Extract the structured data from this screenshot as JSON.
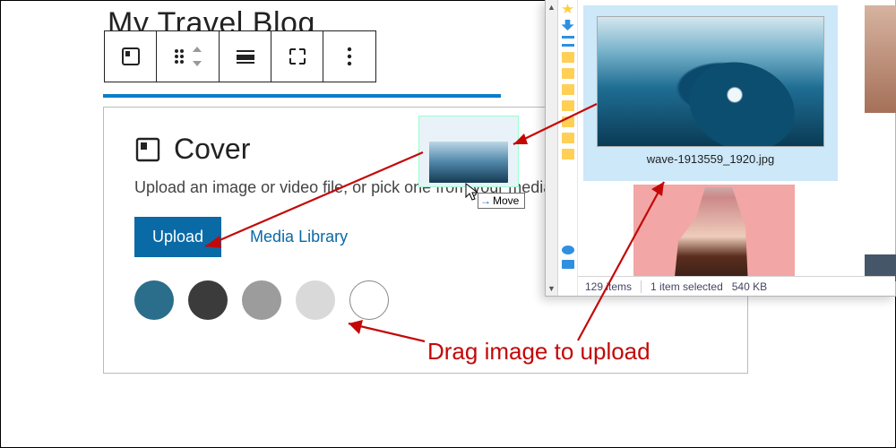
{
  "page": {
    "title": "My Travel Blog"
  },
  "toolbar": {
    "icons": [
      "cover-icon",
      "drag-handle-icon",
      "arrows-icon",
      "align-icon",
      "fullwidth-icon",
      "more-icon"
    ]
  },
  "cover": {
    "title": "Cover",
    "description": "Upload an image or video file, or pick one from your media library.",
    "upload": "Upload",
    "media_library": "Media Library",
    "swatches": [
      "#2a6e8c",
      "#3b3b3b",
      "#9c9c9c",
      "#d9d9d9",
      "#ffffff"
    ]
  },
  "drag": {
    "badge": "Move"
  },
  "explorer": {
    "selected_filename": "wave-1913559_1920.jpg",
    "status_count": "129 items",
    "status_selected": "1 item selected",
    "status_size": "540 KB"
  },
  "annotation": {
    "text": "Drag image to upload"
  }
}
